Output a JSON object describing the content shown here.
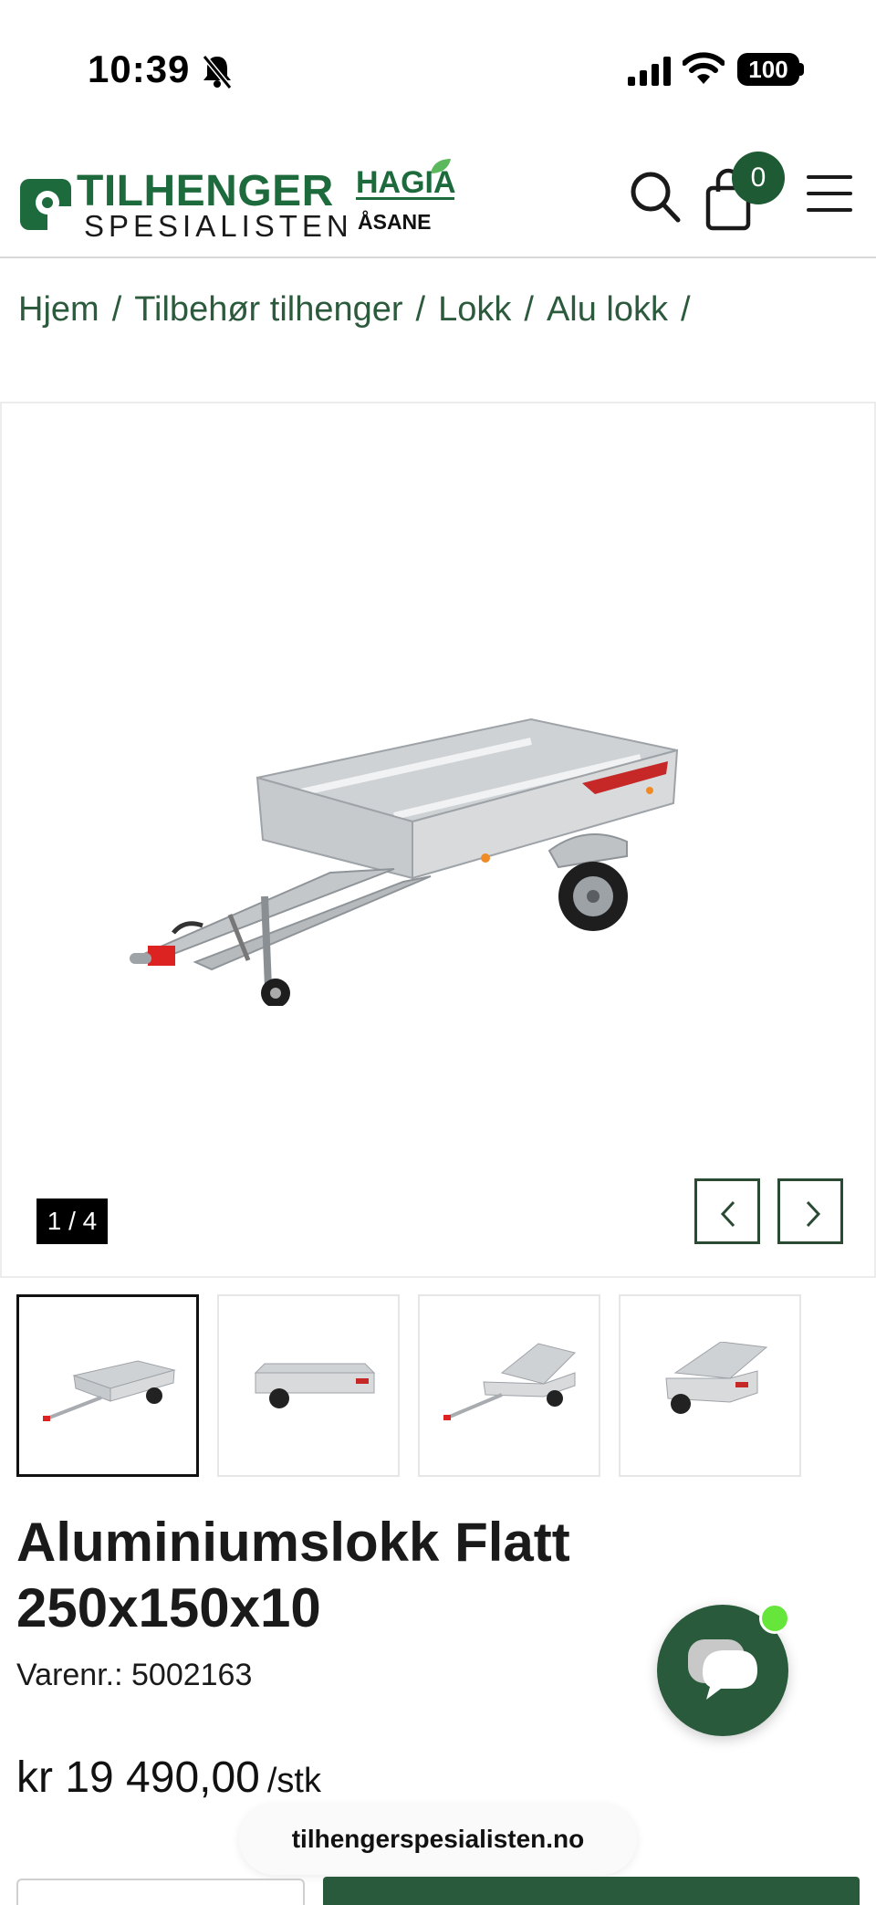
{
  "status_bar": {
    "time": "10:39",
    "battery": "100"
  },
  "header": {
    "logo_title": "TILHENGER",
    "logo_subtitle": "SPESIALISTEN",
    "partner_title": "HAGIA",
    "partner_subtitle": "ÅSANE",
    "cart_count": "0"
  },
  "breadcrumb": {
    "items": [
      "Hjem",
      "Tilbehør tilhenger",
      "Lokk",
      "Alu lokk"
    ],
    "separator": "/"
  },
  "gallery": {
    "counter": "1 / 4",
    "thumbnails": [
      "thumb-1",
      "thumb-2",
      "thumb-3",
      "thumb-4"
    ]
  },
  "product": {
    "title": "Aluminiumslokk Flatt 250x150x10",
    "sku_label": "Varenr.:",
    "sku": "5002163",
    "price": "kr 19 490,00",
    "unit": "/stk"
  },
  "browser": {
    "url": "tilhengerspesialisten.no"
  },
  "colors": {
    "brand_green": "#1d6b3c",
    "dark_green": "#2a5a3c",
    "online_dot": "#66e63a"
  }
}
